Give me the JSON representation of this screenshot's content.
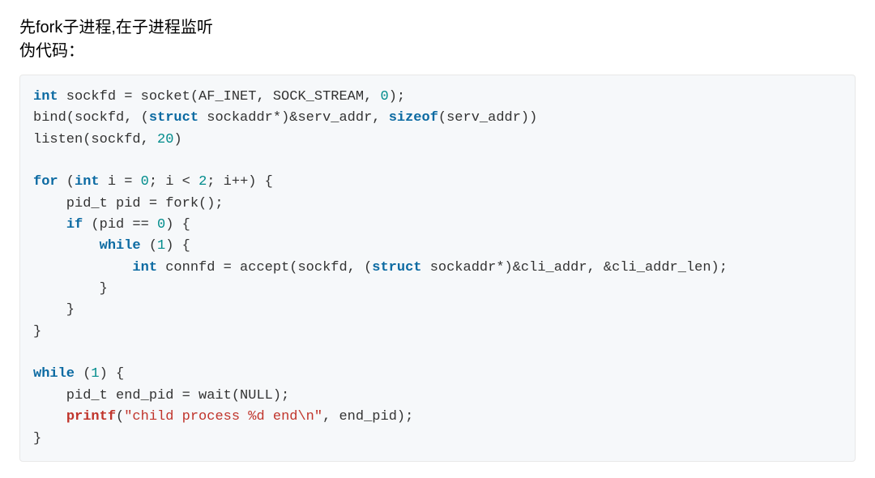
{
  "intro": {
    "line1": "先fork子进程,在子进程监听",
    "line2": "伪代码："
  },
  "code": {
    "kw_int": "int",
    "kw_struct": "struct",
    "kw_sizeof": "sizeof",
    "kw_for": "for",
    "kw_if": "if",
    "kw_while": "while",
    "num_0": "0",
    "num_20": "20",
    "num_2": "2",
    "num_1": "1",
    "fn_printf": "printf",
    "str_lit": "\"child process %d end\\n\"",
    "t1a": " sockfd = socket(AF_INET, SOCK_STREAM, ",
    "t1b": ");",
    "t2a": "bind(sockfd, (",
    "t2b": " sockaddr*)&serv_addr, ",
    "t2c": "(serv_addr))",
    "t3": "listen(sockfd, ",
    "t3b": ")",
    "t5a": " (",
    "t5b": " i = ",
    "t5c": "; i < ",
    "t5d": "; i++) {",
    "t6": "    pid_t pid = fork();",
    "t7a": "    ",
    "t7b": " (pid == ",
    "t7c": ") {",
    "t8a": "        ",
    "t8b": " (",
    "t8c": ") {",
    "t9a": "            ",
    "t9b": " connfd = accept(sockfd, (",
    "t9c": " sockaddr*)&cli_addr, &cli_addr_len);",
    "t10": "        }",
    "t11": "    }",
    "t12": "}",
    "t14b": ") {",
    "t15": "    pid_t end_pid = wait(NULL);",
    "t16a": "    ",
    "t16b": "(",
    "t16c": ", end_pid);",
    "t17": "}"
  }
}
